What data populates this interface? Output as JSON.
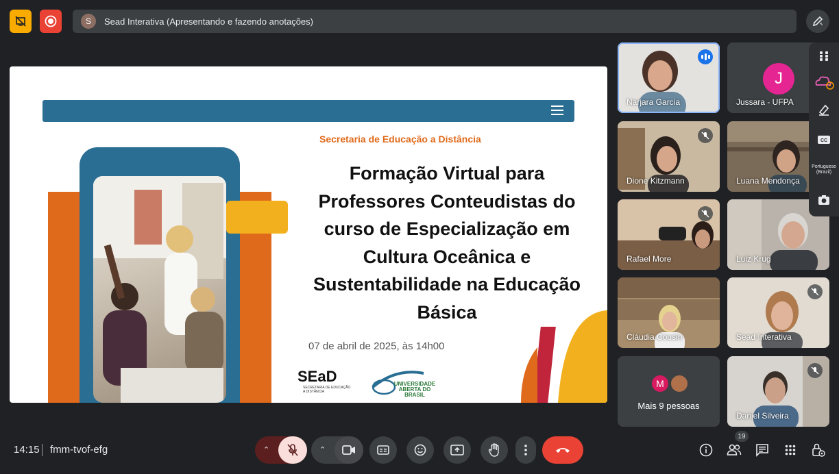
{
  "meeting": {
    "time": "14:15",
    "code": "fmm-tvof-efg"
  },
  "presenting_bar": {
    "avatar_letter": "S",
    "text": "Sead Interativa (Apresentando e fazendo anotações)"
  },
  "slide": {
    "organization": "Secretaria de Educação a Distância",
    "title_lines": [
      "Formação Virtual para",
      "Professores Conteudistas do",
      "curso de Especialização em",
      "Cultura Oceânica e",
      "Sustentabilidade na Educação",
      "Básica"
    ],
    "date": "07 de abril de 2025, às 14h00",
    "logo_sead": "SEaD",
    "logo_sead_sub": "SECRETARIA DE EDUCAÇÃO A DISTÂNCIA",
    "logo_uab": "UNIVERSIDADE ABERTA DO BRASIL"
  },
  "participants": [
    {
      "name": "Narjara Garcia",
      "state": "speaking"
    },
    {
      "name": "Jussara - UFPA",
      "avatar_letter": "J",
      "state": "avatar"
    },
    {
      "name": "Dione Kitzmann",
      "state": "muted"
    },
    {
      "name": "Luana Mendonça",
      "state": "video"
    },
    {
      "name": "Rafael More",
      "state": "muted"
    },
    {
      "name": "Luiz Krug",
      "state": "video"
    },
    {
      "name": "Cláudia Cousin",
      "state": "video"
    },
    {
      "name": "Sead Interativa",
      "state": "muted"
    },
    {
      "name": "Mais 9 pessoas",
      "avatar_letter": "M",
      "state": "more"
    },
    {
      "name": "Daniel Silveira",
      "state": "muted"
    }
  ],
  "side_panel": {
    "caption_language": "Portuguese (Brazil)"
  },
  "participant_count": "19",
  "colors": {
    "background": "#202124",
    "end_call": "#ea4335",
    "mic_muted_bg": "#f9dedc",
    "slide_blue": "#2a6e94",
    "slide_orange": "#e06a1b",
    "avatar_pink": "#e52592"
  },
  "icons": {
    "top": [
      "no-screen-icon",
      "record-icon",
      "edit-pencil-icon"
    ],
    "controls": [
      "mic-off-icon",
      "camera-icon",
      "captions-icon",
      "emoji-icon",
      "present-icon",
      "hand-raise-icon",
      "more-vert-icon",
      "call-end-icon"
    ],
    "right": [
      "info-icon",
      "people-icon",
      "chat-icon",
      "apps-icon",
      "host-controls-icon"
    ]
  }
}
